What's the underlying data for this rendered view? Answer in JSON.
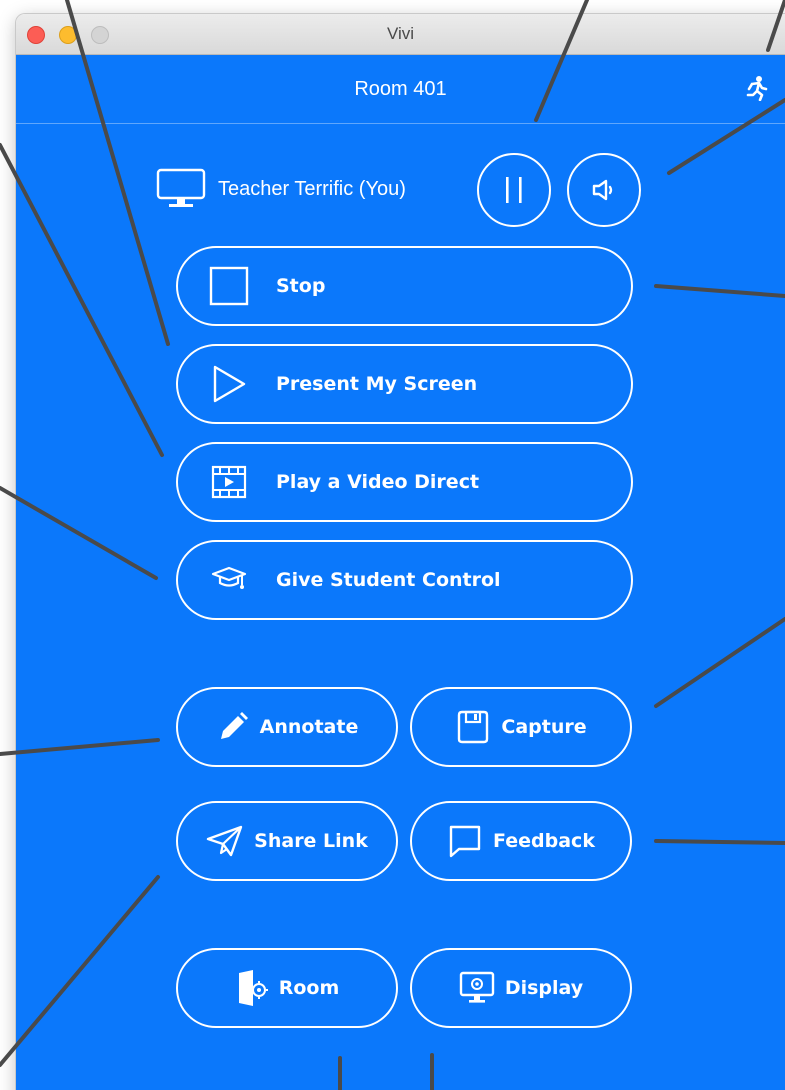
{
  "window": {
    "title": "Vivi"
  },
  "header": {
    "room_name": "Room 401",
    "exit_icon": "running-person-icon"
  },
  "presenter": {
    "name": "Teacher Terrific (You)",
    "icon": "monitor-icon",
    "pause_icon": "pause-icon",
    "volume_icon": "speaker-icon"
  },
  "actions": {
    "stop": "Stop",
    "present_screen": "Present My Screen",
    "play_video": "Play a Video Direct",
    "student_control": "Give Student Control"
  },
  "tools": {
    "annotate": "Annotate",
    "capture": "Capture",
    "share_link": "Share Link",
    "feedback": "Feedback"
  },
  "settings": {
    "room": "Room",
    "display": "Display"
  },
  "colors": {
    "background": "#0b78fb",
    "foreground": "#ffffff",
    "callout_lines": "#4a4a4a"
  }
}
